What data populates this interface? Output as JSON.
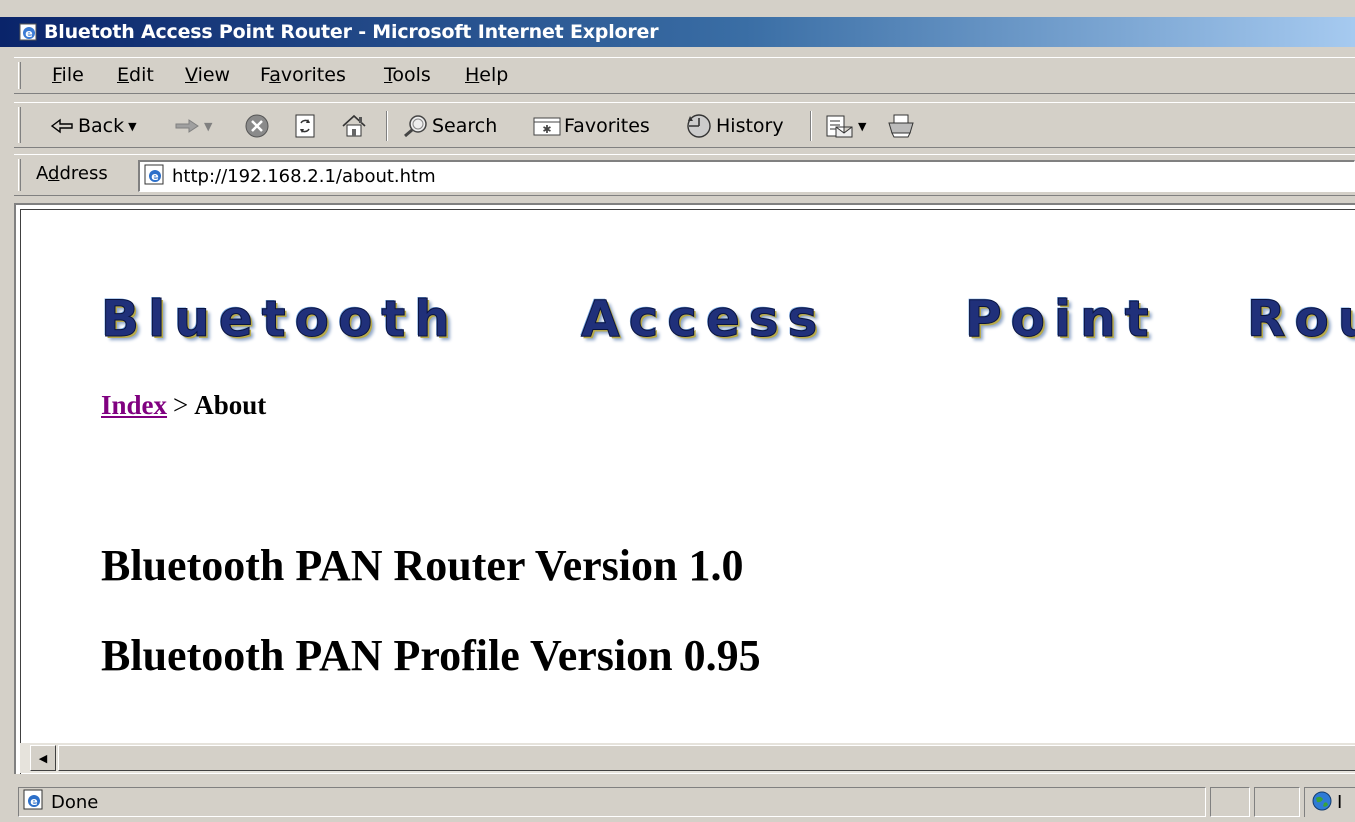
{
  "window": {
    "title": "Bluetoth Access Point Router - Microsoft Internet Explorer"
  },
  "menubar": {
    "items": [
      {
        "acc": "F",
        "rest": "ile"
      },
      {
        "acc": "E",
        "rest": "dit"
      },
      {
        "acc": "V",
        "rest": "iew"
      },
      {
        "pre": "F",
        "acc": "a",
        "rest": "vorites"
      },
      {
        "acc": "T",
        "rest": "ools"
      },
      {
        "acc": "H",
        "rest": "elp"
      }
    ]
  },
  "toolbar": {
    "back_label": "Back",
    "search_label": "Search",
    "favorites_label": "Favorites",
    "history_label": "History"
  },
  "address": {
    "label_pre": "A",
    "label_acc": "d",
    "label_rest": "dress",
    "url": "http://192.168.2.1/about.htm"
  },
  "page": {
    "banner_words": [
      "Bluetooth",
      "Access",
      "Point",
      "Router"
    ],
    "breadcrumb": {
      "link": "Index",
      "separator": ">",
      "current": "About"
    },
    "versions": [
      "Bluetooth PAN Router Version 1.0",
      "Bluetooth PAN Profile Version 0.95"
    ]
  },
  "status": {
    "text": "Done",
    "zone_text": "I"
  },
  "colors": {
    "title_gradient_start": "#0a246a",
    "title_gradient_end": "#a6caf0",
    "visited_link": "#800080",
    "chrome": "#d4d0c8"
  }
}
